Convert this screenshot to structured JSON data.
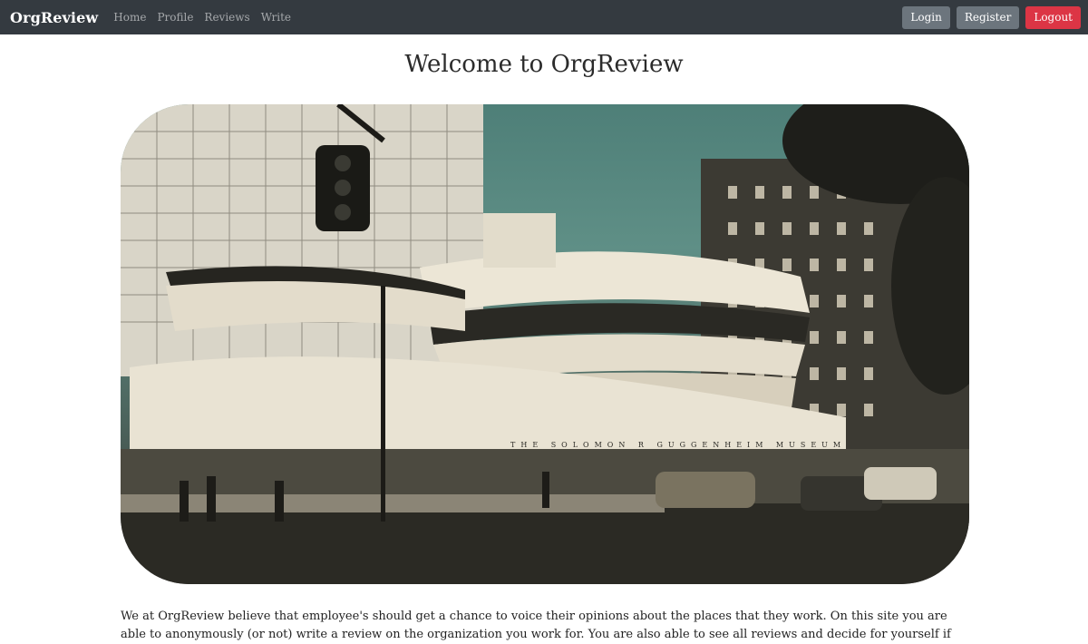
{
  "navbar": {
    "brand": "OrgReview",
    "links": [
      "Home",
      "Profile",
      "Reviews",
      "Write"
    ],
    "buttons": {
      "login": "Login",
      "register": "Register",
      "logout": "Logout"
    }
  },
  "main": {
    "title": "Welcome to OrgReview",
    "hero_sign": "THE SOLOMON R GUGGENHEIM MUSEUM",
    "intro_text": "We at OrgReview believe that employee's should get a chance to voice their opinions about the places that they work. On this site you are able to anonymously (or not) write a review on the organization you work for. You are also able to see all reviews and decide for yourself if"
  },
  "colors": {
    "navbar_bg": "#343a40",
    "button_secondary": "#6c757d",
    "button_danger": "#dc3545"
  }
}
